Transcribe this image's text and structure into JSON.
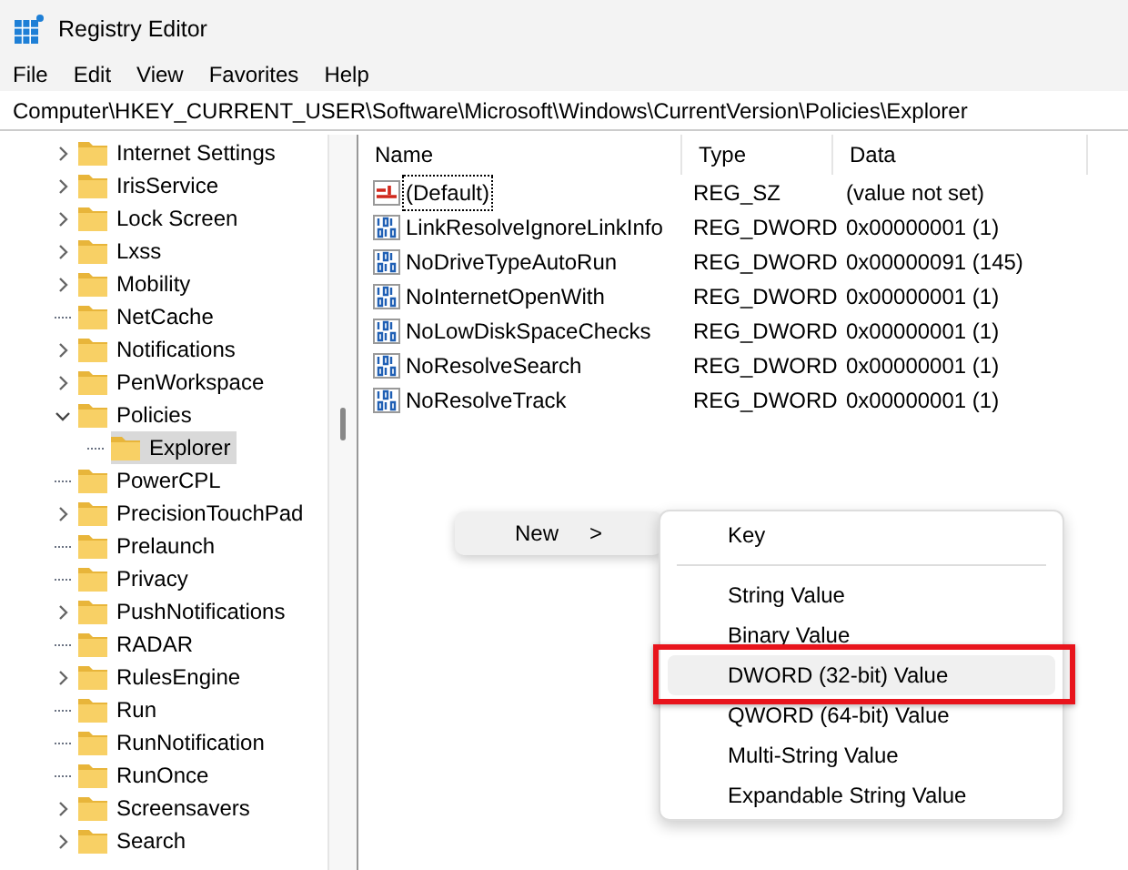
{
  "window": {
    "title": "Registry Editor"
  },
  "menu_bar": [
    "File",
    "Edit",
    "View",
    "Favorites",
    "Help"
  ],
  "address": "Computer\\HKEY_CURRENT_USER\\Software\\Microsoft\\Windows\\CurrentVersion\\Policies\\Explorer",
  "tree": [
    {
      "label": "Internet Settings",
      "has_children": true,
      "expanded": false,
      "selected": false
    },
    {
      "label": "IrisService",
      "has_children": true,
      "expanded": false,
      "selected": false
    },
    {
      "label": "Lock Screen",
      "has_children": true,
      "expanded": false,
      "selected": false
    },
    {
      "label": "Lxss",
      "has_children": true,
      "expanded": false,
      "selected": false
    },
    {
      "label": "Mobility",
      "has_children": true,
      "expanded": false,
      "selected": false
    },
    {
      "label": "NetCache",
      "has_children": false,
      "selected": false
    },
    {
      "label": "Notifications",
      "has_children": true,
      "expanded": false,
      "selected": false
    },
    {
      "label": "PenWorkspace",
      "has_children": true,
      "expanded": false,
      "selected": false
    },
    {
      "label": "Policies",
      "has_children": true,
      "expanded": true,
      "selected": false,
      "children": [
        {
          "label": "Explorer",
          "has_children": false,
          "selected": true
        }
      ]
    },
    {
      "label": "PowerCPL",
      "has_children": false,
      "selected": false
    },
    {
      "label": "PrecisionTouchPad",
      "has_children": true,
      "expanded": false,
      "selected": false
    },
    {
      "label": "Prelaunch",
      "has_children": false,
      "selected": false
    },
    {
      "label": "Privacy",
      "has_children": false,
      "selected": false
    },
    {
      "label": "PushNotifications",
      "has_children": true,
      "expanded": false,
      "selected": false
    },
    {
      "label": "RADAR",
      "has_children": false,
      "selected": false
    },
    {
      "label": "RulesEngine",
      "has_children": true,
      "expanded": false,
      "selected": false
    },
    {
      "label": "Run",
      "has_children": false,
      "selected": false
    },
    {
      "label": "RunNotification",
      "has_children": false,
      "selected": false
    },
    {
      "label": "RunOnce",
      "has_children": false,
      "selected": false
    },
    {
      "label": "Screensavers",
      "has_children": true,
      "expanded": false,
      "selected": false
    },
    {
      "label": "Search",
      "has_children": true,
      "expanded": false,
      "selected": false
    }
  ],
  "table": {
    "columns": [
      "Name",
      "Type",
      "Data"
    ],
    "rows": [
      {
        "kind": "string",
        "name": "(Default)",
        "type": "REG_SZ",
        "data": "(value not set)",
        "focused": true
      },
      {
        "kind": "dword",
        "name": "LinkResolveIgnoreLinkInfo",
        "type": "REG_DWORD",
        "data": "0x00000001 (1)",
        "focused": false
      },
      {
        "kind": "dword",
        "name": "NoDriveTypeAutoRun",
        "type": "REG_DWORD",
        "data": "0x00000091 (145)",
        "focused": false
      },
      {
        "kind": "dword",
        "name": "NoInternetOpenWith",
        "type": "REG_DWORD",
        "data": "0x00000001 (1)",
        "focused": false
      },
      {
        "kind": "dword",
        "name": "NoLowDiskSpaceChecks",
        "type": "REG_DWORD",
        "data": "0x00000001 (1)",
        "focused": false
      },
      {
        "kind": "dword",
        "name": "NoResolveSearch",
        "type": "REG_DWORD",
        "data": "0x00000001 (1)",
        "focused": false
      },
      {
        "kind": "dword",
        "name": "NoResolveTrack",
        "type": "REG_DWORD",
        "data": "0x00000001 (1)",
        "focused": false
      }
    ]
  },
  "context_menu": {
    "label": "New",
    "arrow": ">"
  },
  "submenu": [
    {
      "kind": "item",
      "label": "Key",
      "highlighted": false,
      "callout": false
    },
    {
      "kind": "separator"
    },
    {
      "kind": "item",
      "label": "String Value",
      "highlighted": false,
      "callout": false
    },
    {
      "kind": "item",
      "label": "Binary Value",
      "highlighted": false,
      "callout": false
    },
    {
      "kind": "item",
      "label": "DWORD (32-bit) Value",
      "highlighted": true,
      "callout": true
    },
    {
      "kind": "item",
      "label": "QWORD (64-bit) Value",
      "highlighted": false,
      "callout": false
    },
    {
      "kind": "item",
      "label": "Multi-String Value",
      "highlighted": false,
      "callout": false
    },
    {
      "kind": "item",
      "label": "Expandable String Value",
      "highlighted": false,
      "callout": false
    }
  ]
}
